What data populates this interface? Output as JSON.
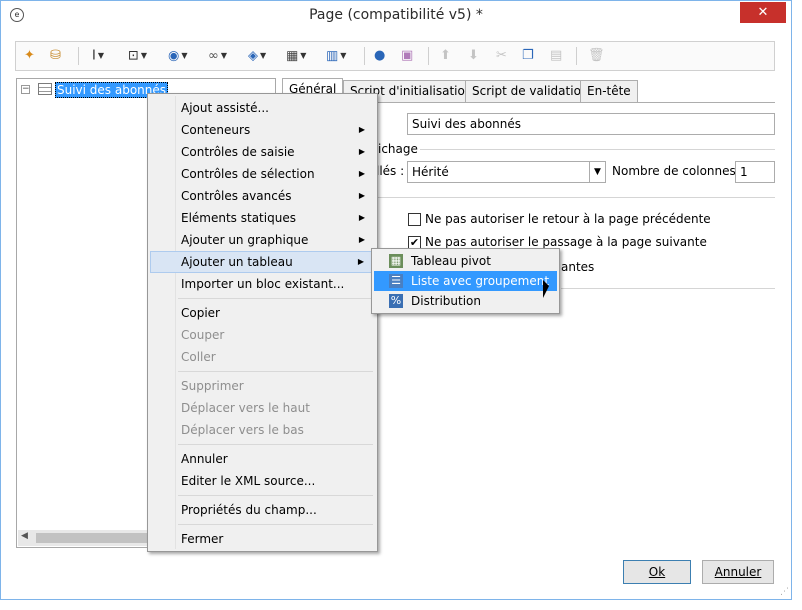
{
  "window": {
    "title": "Page (compatibilité v5) *"
  },
  "toolbar": {
    "icons": [
      "magic-wand-icon",
      "database-icon",
      "text-cursor-icon",
      "insert-icon",
      "globe-icon",
      "link-icon",
      "layers-icon",
      "grid-icon",
      "columns-icon",
      "person-icon",
      "add-group-icon",
      "move-up-icon",
      "move-down-icon",
      "cut-icon",
      "copy-icon",
      "paste-icon",
      "delete-icon"
    ]
  },
  "tree": {
    "root_label": "Suivi des abonnés"
  },
  "tabs": [
    "Général",
    "Script d'initialisation",
    "Script de validation",
    "En-tête"
  ],
  "form": {
    "title_value": "Suivi des abonnés",
    "group_label": "ichage",
    "styles_label": "llés :",
    "styles_value": "Hérité",
    "columns_label": "Nombre de colonnes :",
    "columns_value": "1",
    "checkbox_prev": {
      "label": "Ne pas autoriser le retour à la page précédente",
      "checked": false
    },
    "checkbox_next": {
      "label": "Ne pas autoriser le passage à la page suivante",
      "checked": true
    },
    "partial_label": "antes"
  },
  "context_menu": {
    "items": [
      {
        "label": "Ajout assisté...",
        "disabled": false,
        "submenu": false
      },
      {
        "label": "Conteneurs",
        "disabled": false,
        "submenu": true
      },
      {
        "label": "Contrôles de saisie",
        "disabled": false,
        "submenu": true
      },
      {
        "label": "Contrôles de sélection",
        "disabled": false,
        "submenu": true
      },
      {
        "label": "Contrôles avancés",
        "disabled": false,
        "submenu": true
      },
      {
        "label": "Eléments statiques",
        "disabled": false,
        "submenu": true
      },
      {
        "label": "Ajouter un graphique",
        "disabled": false,
        "submenu": true
      },
      {
        "label": "Ajouter un tableau",
        "disabled": false,
        "submenu": true
      },
      {
        "label": "Importer un bloc existant...",
        "disabled": false,
        "submenu": false
      },
      {
        "label": "Copier",
        "disabled": false,
        "submenu": false
      },
      {
        "label": "Couper",
        "disabled": true,
        "submenu": false
      },
      {
        "label": "Coller",
        "disabled": true,
        "submenu": false
      },
      {
        "label": "Supprimer",
        "disabled": true,
        "submenu": false
      },
      {
        "label": "Déplacer vers le haut",
        "disabled": true,
        "submenu": false
      },
      {
        "label": "Déplacer vers le bas",
        "disabled": true,
        "submenu": false
      },
      {
        "label": "Annuler",
        "disabled": false,
        "submenu": false
      },
      {
        "label": "Editer le XML source...",
        "disabled": false,
        "submenu": false
      },
      {
        "label": "Propriétés du champ...",
        "disabled": false,
        "submenu": false
      },
      {
        "label": "Fermer",
        "disabled": false,
        "submenu": false
      }
    ]
  },
  "submenu": {
    "items": [
      {
        "label": "Tableau pivot",
        "icon": "pivot-table-icon"
      },
      {
        "label": "Liste avec groupement",
        "icon": "grouped-list-icon"
      },
      {
        "label": "Distribution",
        "icon": "distribution-icon"
      }
    ]
  },
  "buttons": {
    "ok": "Ok",
    "cancel": "Annuler"
  },
  "colors": {
    "selection": "#3399ff",
    "close": "#c7302b",
    "menu_bg": "#f0f0f0",
    "menu_hover": "#d9e5f4"
  }
}
